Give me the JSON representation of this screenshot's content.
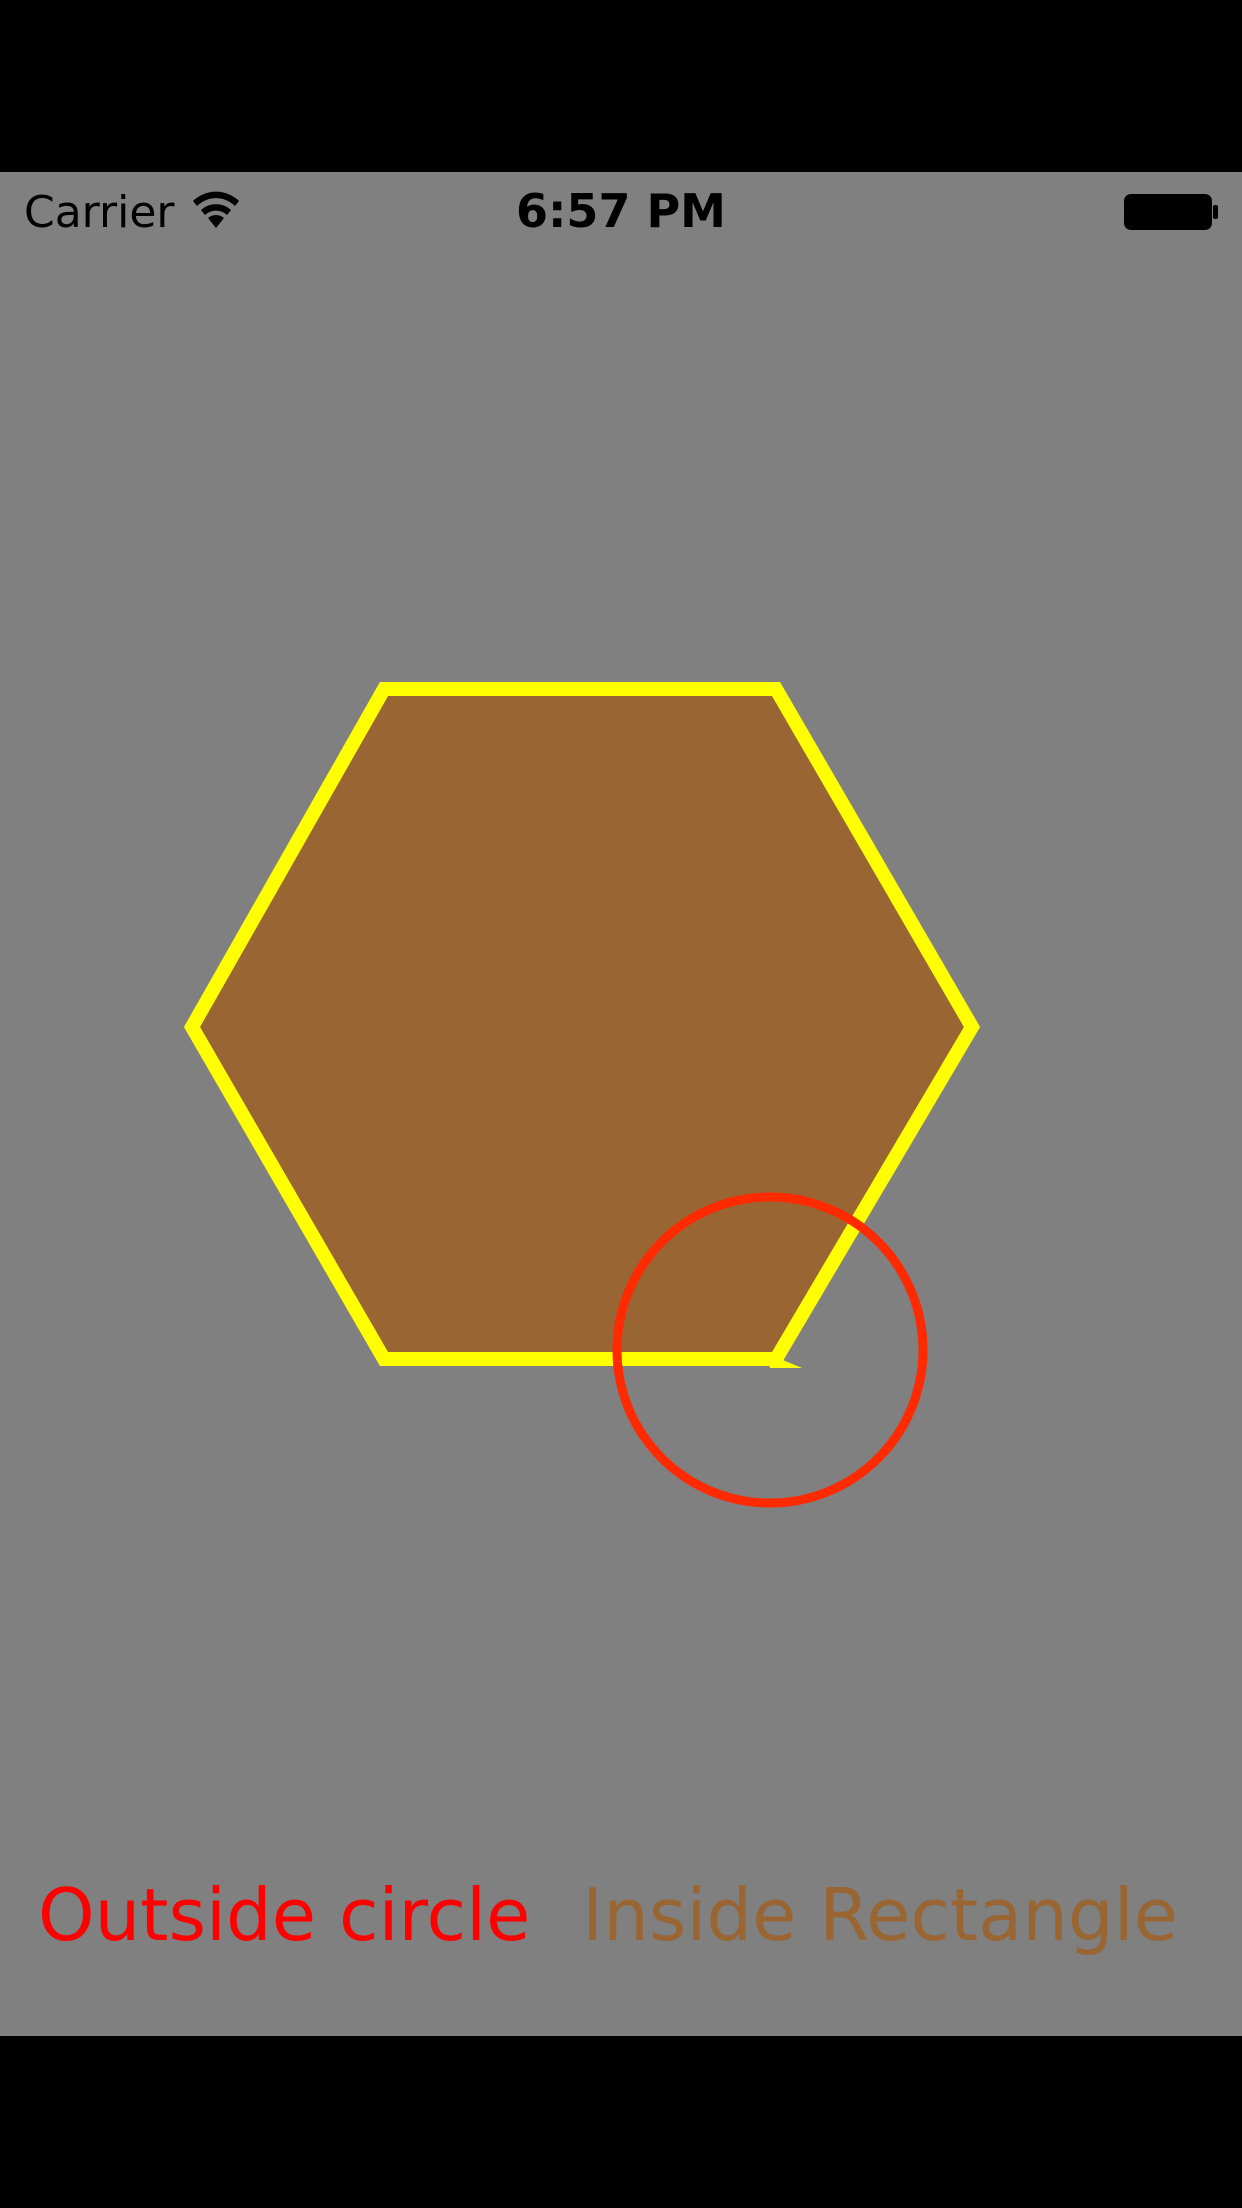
{
  "status_bar": {
    "carrier": "Carrier",
    "time": "6:57 PM",
    "wifi_icon": "wifi-icon",
    "battery_icon": "battery-icon"
  },
  "shapes": {
    "hexagon": {
      "fill": "#996633",
      "stroke": "#FFFF00"
    },
    "circle": {
      "stroke": "#FF2A00"
    }
  },
  "labels": {
    "outside": {
      "text": "Outside circle",
      "color": "#FF0000"
    },
    "inside": {
      "text": "Inside Rectangle",
      "color": "#996633"
    }
  },
  "colors": {
    "background": "#808080",
    "letterbox": "#000000"
  }
}
